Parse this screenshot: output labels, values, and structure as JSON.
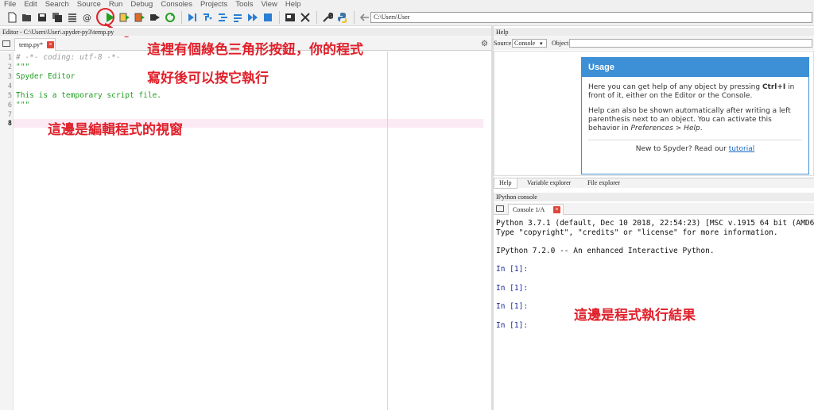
{
  "menu": [
    "File",
    "Edit",
    "Search",
    "Source",
    "Run",
    "Debug",
    "Consoles",
    "Projects",
    "Tools",
    "View",
    "Help"
  ],
  "toolbar": {
    "icons": [
      "new-file-icon",
      "open-icon",
      "save-icon",
      "save-all-icon",
      "outline-icon",
      "at-icon",
      "run-icon",
      "run-cell-icon",
      "run-cell-advance-icon",
      "run-selection-icon",
      "rerun-icon",
      "debug-icon",
      "step-icon",
      "step-into-icon",
      "step-return-icon",
      "continue-icon",
      "stop-icon",
      "maximize-icon",
      "fullscreen-icon",
      "wrench-icon",
      "python-icon",
      "back-arrow-icon",
      "forward-arrow-icon",
      "folder-icon"
    ],
    "cwd": "C:\\Users\\User"
  },
  "editor": {
    "title": "Editor - C:\\Users\\User\\.spyder-py3\\temp.py",
    "tab": "temp.py*",
    "lines": [
      {
        "num": "1",
        "text": "# -*- coding: utf-8 -*-",
        "style": "comment"
      },
      {
        "num": "2",
        "text": "\"\"\"",
        "style": "string"
      },
      {
        "num": "3",
        "text": "Spyder Editor",
        "style": "string"
      },
      {
        "num": "4",
        "text": "",
        "style": "string"
      },
      {
        "num": "5",
        "text": "This is a temporary script file.",
        "style": "string"
      },
      {
        "num": "6",
        "text": "\"\"\"",
        "style": "string"
      },
      {
        "num": "7",
        "text": "",
        "style": "plain"
      },
      {
        "num": "8",
        "text": "",
        "style": "plain"
      }
    ]
  },
  "help": {
    "title": "Help",
    "source_label": "Source",
    "source_value": "Console",
    "object_label": "Object",
    "usage": {
      "heading": "Usage",
      "p1_a": "Here you can get help of any object by pressing ",
      "p1_key": "Ctrl+I",
      "p1_b": " in front of it, either on the Editor or the Console.",
      "p2_a": "Help can also be shown automatically after writing a left parenthesis next to an object. You can activate this behavior in ",
      "p2_pref": "Preferences > Help",
      "p2_b": ".",
      "footer": "New to Spyder? Read our ",
      "link": "tutorial"
    },
    "tabs": [
      "Help",
      "Variable explorer",
      "File explorer"
    ]
  },
  "ipython": {
    "title": "IPython console",
    "tab": "Console 1/A",
    "lines": [
      "Python 3.7.1 (default, Dec 10 2018, 22:54:23) [MSC v.1915 64 bit (AMD64)]",
      "Type \"copyright\", \"credits\" or \"license\" for more information.",
      "IPython 7.2.0 -- An enhanced Interactive Python."
    ],
    "prompts": [
      "In [1]:",
      "In [1]:",
      "In [1]:",
      "In [1]:"
    ]
  },
  "annotations": {
    "run_note_1": "這裡有個綠色三角形按鈕，你的程式",
    "run_note_2": "寫好後可以按它執行",
    "editor_note": "這邊是編輯程式的視窗",
    "console_note": "這邊是程式執行結果"
  },
  "colors": {
    "annotation": "#e0202a",
    "usage_header": "#3d8fd6",
    "run_green": "#21a021",
    "docstring": "#1f9e1f"
  }
}
